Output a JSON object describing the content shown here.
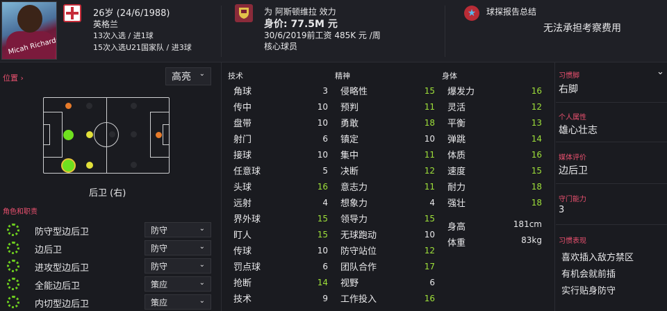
{
  "header": {
    "photo_name": "Micah Richards",
    "age_line": "26岁 (24/6/1988)",
    "nationality": "英格兰",
    "caps": "13次入选 / 进1球",
    "u21_caps": "15次入选U21国家队 / 进3球",
    "club_line": "为 阿斯顿维拉 效力",
    "value": "身价: 77.5M 元",
    "contract": "30/6/2019前工资 485K 元 /周",
    "squad_status": "核心球员",
    "scout_title": "球探报告总结",
    "scout_text": "无法承担考察费用"
  },
  "position": {
    "label": "位置",
    "view_select": "高亮",
    "position_name": "后卫 (右)"
  },
  "roles": {
    "title": "角色和职责",
    "items": [
      {
        "role": "防守型边后卫",
        "duty": "防守"
      },
      {
        "role": "边后卫",
        "duty": "防守"
      },
      {
        "role": "进攻型边后卫",
        "duty": "防守"
      },
      {
        "role": "全能边后卫",
        "duty": "策应"
      },
      {
        "role": "内切型边后卫",
        "duty": "策应"
      }
    ]
  },
  "attributes": {
    "technical_title": "技术",
    "technical": [
      {
        "name": "角球",
        "value": "3",
        "color": "#e8e8ea"
      },
      {
        "name": "传中",
        "value": "10",
        "color": "#e8e8ea"
      },
      {
        "name": "盘带",
        "value": "10",
        "color": "#e8e8ea"
      },
      {
        "name": "射门",
        "value": "6",
        "color": "#e8e8ea"
      },
      {
        "name": "接球",
        "value": "10",
        "color": "#e8e8ea"
      },
      {
        "name": "任意球",
        "value": "5",
        "color": "#e8e8ea"
      },
      {
        "name": "头球",
        "value": "16",
        "color": "#9ee03a"
      },
      {
        "name": "远射",
        "value": "4",
        "color": "#e8e8ea"
      },
      {
        "name": "界外球",
        "value": "15",
        "color": "#9ee03a"
      },
      {
        "name": "盯人",
        "value": "15",
        "color": "#9ee03a"
      },
      {
        "name": "传球",
        "value": "10",
        "color": "#e8e8ea"
      },
      {
        "name": "罚点球",
        "value": "6",
        "color": "#e8e8ea"
      },
      {
        "name": "抢断",
        "value": "14",
        "color": "#9ee03a"
      },
      {
        "name": "技术",
        "value": "9",
        "color": "#e8e8ea"
      }
    ],
    "mental_title": "精神",
    "mental": [
      {
        "name": "侵略性",
        "value": "15",
        "color": "#9ee03a"
      },
      {
        "name": "预判",
        "value": "11",
        "color": "#9ee03a"
      },
      {
        "name": "勇敢",
        "value": "18",
        "color": "#9ee03a"
      },
      {
        "name": "镇定",
        "value": "10",
        "color": "#e8e8ea"
      },
      {
        "name": "集中",
        "value": "11",
        "color": "#9ee03a"
      },
      {
        "name": "决断",
        "value": "12",
        "color": "#9ee03a"
      },
      {
        "name": "意志力",
        "value": "11",
        "color": "#9ee03a"
      },
      {
        "name": "想象力",
        "value": "4",
        "color": "#e8e8ea"
      },
      {
        "name": "领导力",
        "value": "15",
        "color": "#9ee03a"
      },
      {
        "name": "无球跑动",
        "value": "10",
        "color": "#e8e8ea"
      },
      {
        "name": "防守站位",
        "value": "12",
        "color": "#9ee03a"
      },
      {
        "name": "团队合作",
        "value": "17",
        "color": "#9ee03a"
      },
      {
        "name": "视野",
        "value": "6",
        "color": "#e8e8ea"
      },
      {
        "name": "工作投入",
        "value": "16",
        "color": "#9ee03a"
      }
    ],
    "physical_title": "身体",
    "physical": [
      {
        "name": "爆发力",
        "value": "16",
        "color": "#9ee03a"
      },
      {
        "name": "灵活",
        "value": "12",
        "color": "#9ee03a"
      },
      {
        "name": "平衡",
        "value": "13",
        "color": "#9ee03a"
      },
      {
        "name": "弹跳",
        "value": "14",
        "color": "#9ee03a"
      },
      {
        "name": "体质",
        "value": "16",
        "color": "#9ee03a"
      },
      {
        "name": "速度",
        "value": "15",
        "color": "#9ee03a"
      },
      {
        "name": "耐力",
        "value": "18",
        "color": "#9ee03a"
      },
      {
        "name": "强壮",
        "value": "18",
        "color": "#9ee03a"
      }
    ],
    "height_label": "身高",
    "height_value": "181cm",
    "weight_label": "体重",
    "weight_value": "83kg"
  },
  "info": {
    "foot_label": "习惯脚",
    "foot_value": "右脚",
    "personality_label": "个人属性",
    "personality_value": "雄心壮志",
    "media_label": "媒体评价",
    "media_value": "边后卫",
    "gk_label": "守门能力",
    "gk_value": "3",
    "habits_label": "习惯表现",
    "habits": [
      "喜欢插入敌方禁区",
      "有机会就前插",
      "实行贴身防守"
    ]
  }
}
